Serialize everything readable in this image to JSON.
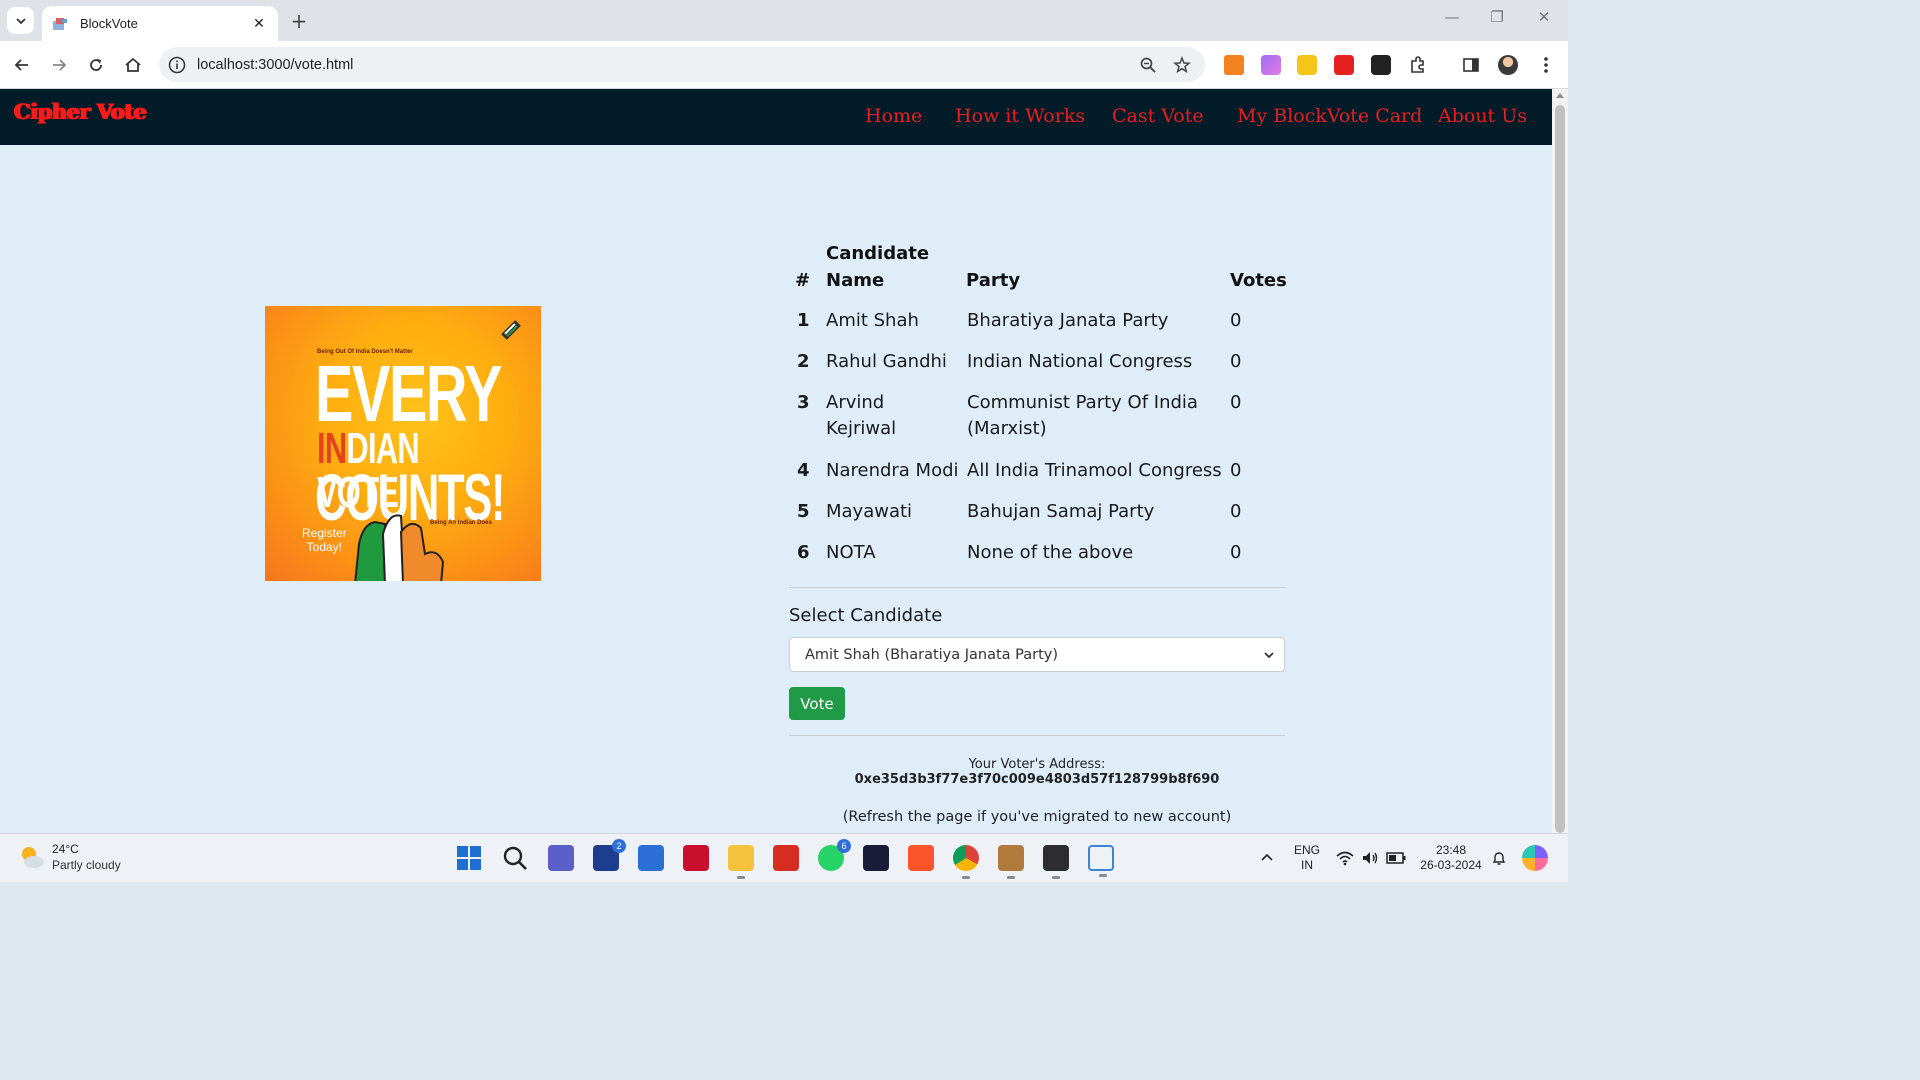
{
  "browser": {
    "tab_title": "BlockVote",
    "url": "localhost:3000/vote.html"
  },
  "navbar": {
    "brand": "Cipher Vote",
    "links": [
      "Home",
      "How it Works",
      "Cast Vote",
      "My BlockVote Card",
      "About Us"
    ]
  },
  "poster": {
    "small_top": "Being Out Of India Doesn't Matter",
    "line1": "EVERY",
    "line2_in": "IN",
    "line2_dian": "DIAN",
    "line2_vote": " VOTE",
    "line3": "COUNTS!",
    "small_right": "Being An Indian Does",
    "register": "Register",
    "today": "Today!"
  },
  "table": {
    "headers": {
      "num": "#",
      "name_line1": "Candidate",
      "name_line2": "Name",
      "party": "Party",
      "votes": "Votes"
    },
    "rows": [
      {
        "num": "1",
        "name": "Amit Shah",
        "party": "Bharatiya Janata Party",
        "votes": "0"
      },
      {
        "num": "2",
        "name": "Rahul Gandhi",
        "party": "Indian National Congress",
        "votes": "0"
      },
      {
        "num": "3",
        "name_l1": "Arvind",
        "name_l2": "Kejriwal",
        "party_l1": "Communist Party Of India",
        "party_l2": "(Marxist)",
        "votes": "0"
      },
      {
        "num": "4",
        "name": "Narendra Modi",
        "party": "All India Trinamool Congress",
        "votes": "0"
      },
      {
        "num": "5",
        "name": "Mayawati",
        "party": "Bahujan Samaj Party",
        "votes": "0"
      },
      {
        "num": "6",
        "name": "NOTA",
        "party": "None of the above",
        "votes": "0"
      }
    ]
  },
  "form": {
    "label": "Select Candidate",
    "selected": "Amit Shah (Bharatiya Janata Party)",
    "vote_button": "Vote"
  },
  "voter": {
    "label": "Your Voter's Address: ",
    "address": "0xe35d3b3f77e3f70c009e4803d57f128799b8f690",
    "note": "(Refresh the page if you've migrated to new account)"
  },
  "taskbar": {
    "temp": "24°C",
    "weather": "Partly cloudy",
    "badge_l": "2",
    "badge_wa": "6",
    "lang1": "ENG",
    "lang2": "IN",
    "time": "23:48",
    "date": "26-03-2024"
  },
  "colors": {
    "navbar_bg": "#021b29",
    "brand_red": "#ff1a1a",
    "page_bg": "#dfedf9",
    "vote_green": "#1f9a46"
  }
}
